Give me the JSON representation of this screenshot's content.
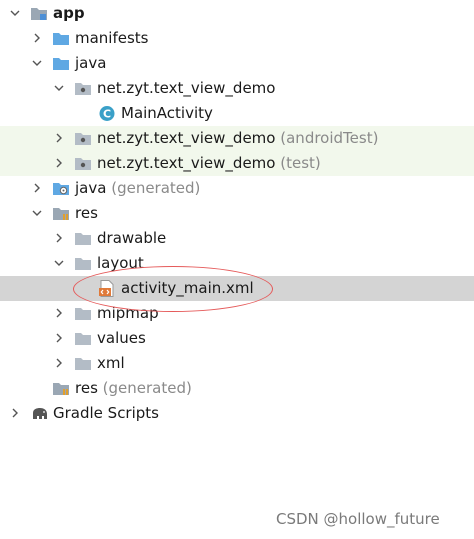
{
  "tree": {
    "app": "app",
    "manifests": "manifests",
    "java": "java",
    "pkg_main": "net.zyt.text_view_demo",
    "main_activity": "MainActivity",
    "pkg_android_test": "net.zyt.text_view_demo",
    "android_test_suffix": "(androidTest)",
    "pkg_test": "net.zyt.text_view_demo",
    "test_suffix": "(test)",
    "java_generated": "java",
    "java_generated_suffix": "(generated)",
    "res": "res",
    "drawable": "drawable",
    "layout": "layout",
    "activity_main": "activity_main.xml",
    "mipmap": "mipmap",
    "values": "values",
    "xml": "xml",
    "res_generated": "res",
    "res_generated_suffix": "(generated)",
    "gradle_scripts": "Gradle Scripts"
  },
  "watermark": "CSDN @hollow_future",
  "colors": {
    "folder_blue": "#5fa8e3",
    "folder_gray": "#9aa7b4",
    "class_badge": "#3aa0c8",
    "selection": "#d4d4d4",
    "test_highlight": "#f2f8ec",
    "annotation_oval": "#e55a5a"
  }
}
